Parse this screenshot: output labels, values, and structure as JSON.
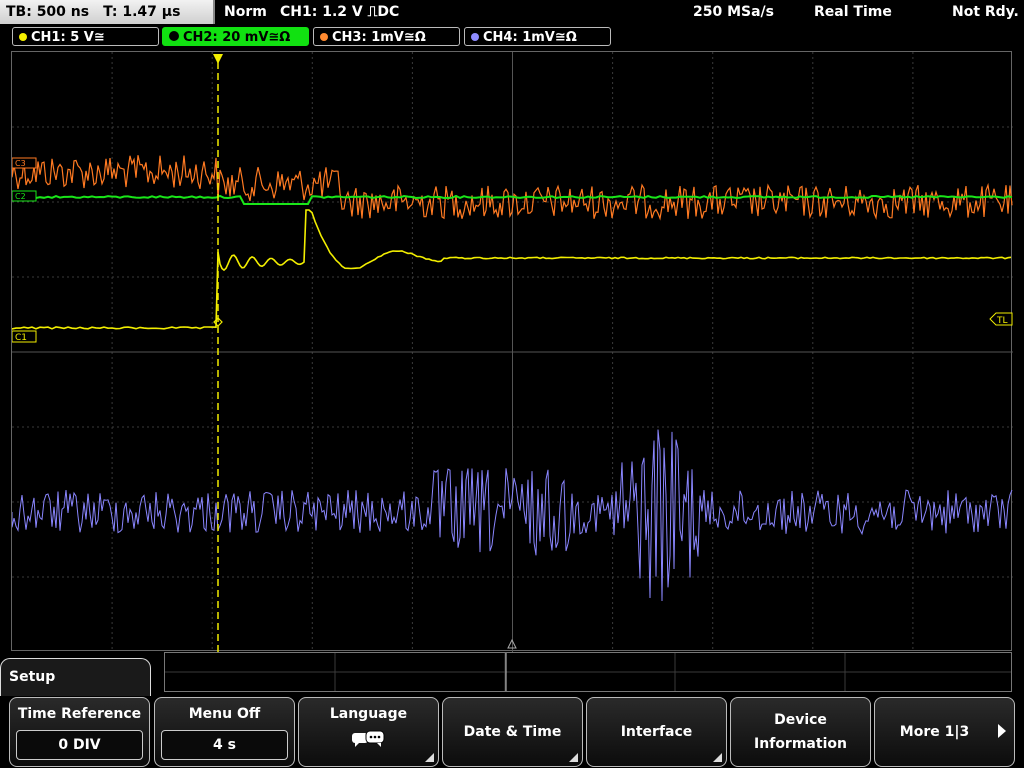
{
  "status": {
    "timebase": "TB: 500 ns",
    "trigger_time": "T: 1.47 µs",
    "mode": "Norm",
    "trigger": "CH1: 1.2 V ⎍DC",
    "sample_rate": "250 MSa/s",
    "acq_mode": "Real Time",
    "ready": "Not Rdy."
  },
  "channels": [
    {
      "label": "CH1: 5 V≅",
      "color": "#f6f000",
      "active": false
    },
    {
      "label": "CH2: 20 mV≅Ω",
      "color": "#11e111",
      "active": true
    },
    {
      "label": "CH3: 1mV≅Ω",
      "color": "#ff8a30",
      "active": false
    },
    {
      "label": "CH4: 1mV≅Ω",
      "color": "#8f8cff",
      "active": false
    }
  ],
  "markers": {
    "ch1": "C1",
    "ch2": "C2",
    "ch3": "C3",
    "trigger_level": "TL"
  },
  "menu": {
    "title": "Setup",
    "buttons": [
      {
        "label": "Time Reference",
        "value": "0 DIV",
        "type": "value"
      },
      {
        "label": "Menu Off",
        "value": "4 s",
        "type": "value"
      },
      {
        "label": "Language",
        "icon": "speech-bubbles-icon",
        "type": "submenu"
      },
      {
        "label": "Date & Time",
        "type": "submenu"
      },
      {
        "label": "Interface",
        "type": "submenu"
      },
      {
        "label1": "Device",
        "label2": "Information",
        "type": "two-line"
      },
      {
        "label": "More 1|3",
        "type": "more"
      }
    ]
  }
}
